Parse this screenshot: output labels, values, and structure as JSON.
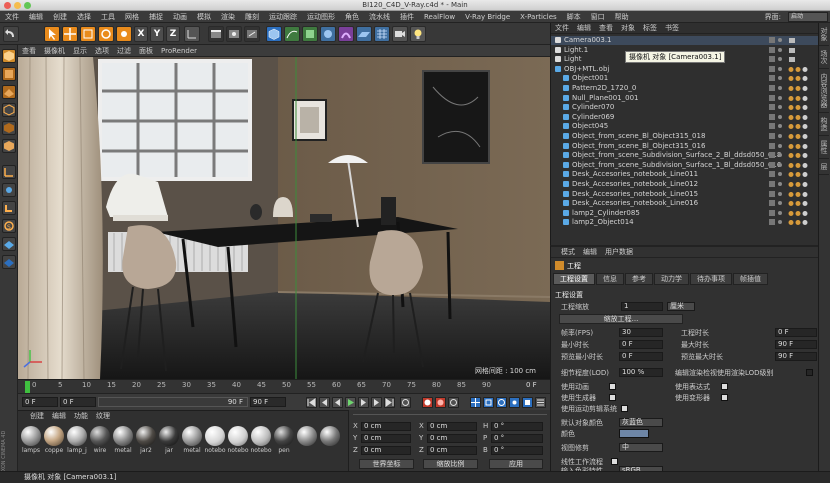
{
  "window": {
    "title": "BI120_C4D_V-Ray.c4d * - Main"
  },
  "menu": [
    "文件",
    "编辑",
    "创建",
    "选择",
    "工具",
    "网格",
    "捕捉",
    "动画",
    "模拟",
    "渲染",
    "雕刻",
    "运动跟踪",
    "运动图形",
    "角色",
    "流水线",
    "插件",
    "RealFlow",
    "V-Ray Bridge",
    "X-Particles",
    "脚本",
    "窗口",
    "帮助"
  ],
  "layout": {
    "label": "界面:",
    "value": "启动"
  },
  "toolbar": {
    "x": "X",
    "y": "Y",
    "z": "Z"
  },
  "viewport": {
    "menu": [
      "查看",
      "摄像机",
      "显示",
      "选项",
      "过滤",
      "面板",
      "ProRender"
    ],
    "grid_info": "网格间距 : 100 cm"
  },
  "timeline": {
    "ticks": [
      "0",
      "5",
      "10",
      "15",
      "20",
      "25",
      "30",
      "35",
      "40",
      "45",
      "50",
      "55",
      "60",
      "65",
      "70",
      "75",
      "80",
      "85",
      "90"
    ],
    "end_field": "0 F"
  },
  "playback": {
    "start": "0 F",
    "current": "0 F",
    "end": "90 F",
    "max": "90 F"
  },
  "materials": {
    "menu": [
      "创建",
      "编辑",
      "功能",
      "纹理"
    ],
    "items": [
      "lamps",
      "coppe",
      "lamp_j",
      "wire",
      "metal",
      "jar2",
      "jar",
      "metal",
      "notebo",
      "notebo",
      "notebo",
      "pen"
    ]
  },
  "coords": {
    "rows": [
      {
        "a": "X",
        "av": "0 cm",
        "b": "X",
        "bv": "0 cm",
        "c": "H",
        "cv": "0 °"
      },
      {
        "a": "Y",
        "av": "0 cm",
        "b": "Y",
        "bv": "0 cm",
        "c": "P",
        "cv": "0 °"
      },
      {
        "a": "Z",
        "av": "0 cm",
        "b": "Z",
        "bv": "0 cm",
        "c": "B",
        "cv": "0 °"
      }
    ],
    "world": "世界坐标",
    "scale": "缩放比例",
    "apply": "应用"
  },
  "objects": {
    "menu": [
      "文件",
      "编辑",
      "查看",
      "对象",
      "标签",
      "书签"
    ],
    "tooltip": "摄像机 对象 [Camera003.1]",
    "items": [
      {
        "name": "Camera003.1",
        "indent": 0
      },
      {
        "name": "Light.1",
        "indent": 0
      },
      {
        "name": "Light",
        "indent": 0
      },
      {
        "name": "OBJ+MTL.obj",
        "indent": 0
      },
      {
        "name": "Object001",
        "indent": 1
      },
      {
        "name": "Pattern2D_1720_0",
        "indent": 1
      },
      {
        "name": "Null_Plane001_001",
        "indent": 1
      },
      {
        "name": "Cylinder070",
        "indent": 1
      },
      {
        "name": "Cylinder069",
        "indent": 1
      },
      {
        "name": "Object045",
        "indent": 1
      },
      {
        "name": "Object_from_scene_Bl_Object315_018",
        "indent": 1
      },
      {
        "name": "Object_from_scene_Bl_Object315_016",
        "indent": 1
      },
      {
        "name": "Object_from_scene_Subdivision_Surface_2_Bl_ddsd050_018",
        "indent": 1
      },
      {
        "name": "Object_from_scene_Subdivision_Surface_1_Bl_ddsd050_016",
        "indent": 1
      },
      {
        "name": "Desk_Accesories_notebook_Line011",
        "indent": 1
      },
      {
        "name": "Desk_Accesories_notebook_Line012",
        "indent": 1
      },
      {
        "name": "Desk_Accesories_notebook_Line015",
        "indent": 1
      },
      {
        "name": "Desk_Accesories_notebook_Line016",
        "indent": 1
      },
      {
        "name": "lamp2_Cylinder085",
        "indent": 1
      },
      {
        "name": "lamp2_Object014",
        "indent": 1
      }
    ]
  },
  "attributes": {
    "menu": [
      "模式",
      "编辑",
      "用户数据"
    ],
    "title": "工程",
    "tabs": [
      "工程设置",
      "信息",
      "参考",
      "动力学",
      "待办事项",
      "帧插值"
    ],
    "section": "工程设置",
    "project_scale_label": "工程缩放",
    "project_scale_value": "1",
    "project_scale_unit": "厘米",
    "scale_button": "缩放工程...",
    "fps_label": "帧率(FPS)",
    "fps_value": "30",
    "project_time_label": "工程时长",
    "project_time_value": "0 F",
    "min_time_label": "最小时长",
    "min_time_value": "0 F",
    "max_time_label": "最大时长",
    "max_time_value": "90 F",
    "preview_min_label": "预览最小时长",
    "preview_min_value": "0 F",
    "preview_max_label": "预览最大时长",
    "preview_max_value": "90 F",
    "lod_label": "细节程度(LOD)",
    "lod_value": "100 %",
    "lod_render_label": "编辑渲染检视使用渲染LOD级别",
    "use_anim": "使用动画",
    "use_expr": "使用表达式",
    "use_gen": "使用生成器",
    "use_deform": "使用变形器",
    "use_motion": "使用运动剪辑系统",
    "default_color_label": "默认对象颜色",
    "default_color_value": "灰蓝色",
    "color_label": "颜色",
    "view_clip_label": "视图修剪",
    "view_clip_value": "中",
    "linear_label": "线性工作流程",
    "input_color_label": "输入色彩特性",
    "input_color_value": "sRGB",
    "default_color_hex": "#6e86a6"
  },
  "side_tabs": [
    "对象",
    "场次",
    "内容浏览器",
    "构造",
    "属性",
    "层"
  ],
  "status": {
    "text": "摄像机 对象 [Camera003.1]",
    "logo": "MAXON CINEMA 4D"
  }
}
